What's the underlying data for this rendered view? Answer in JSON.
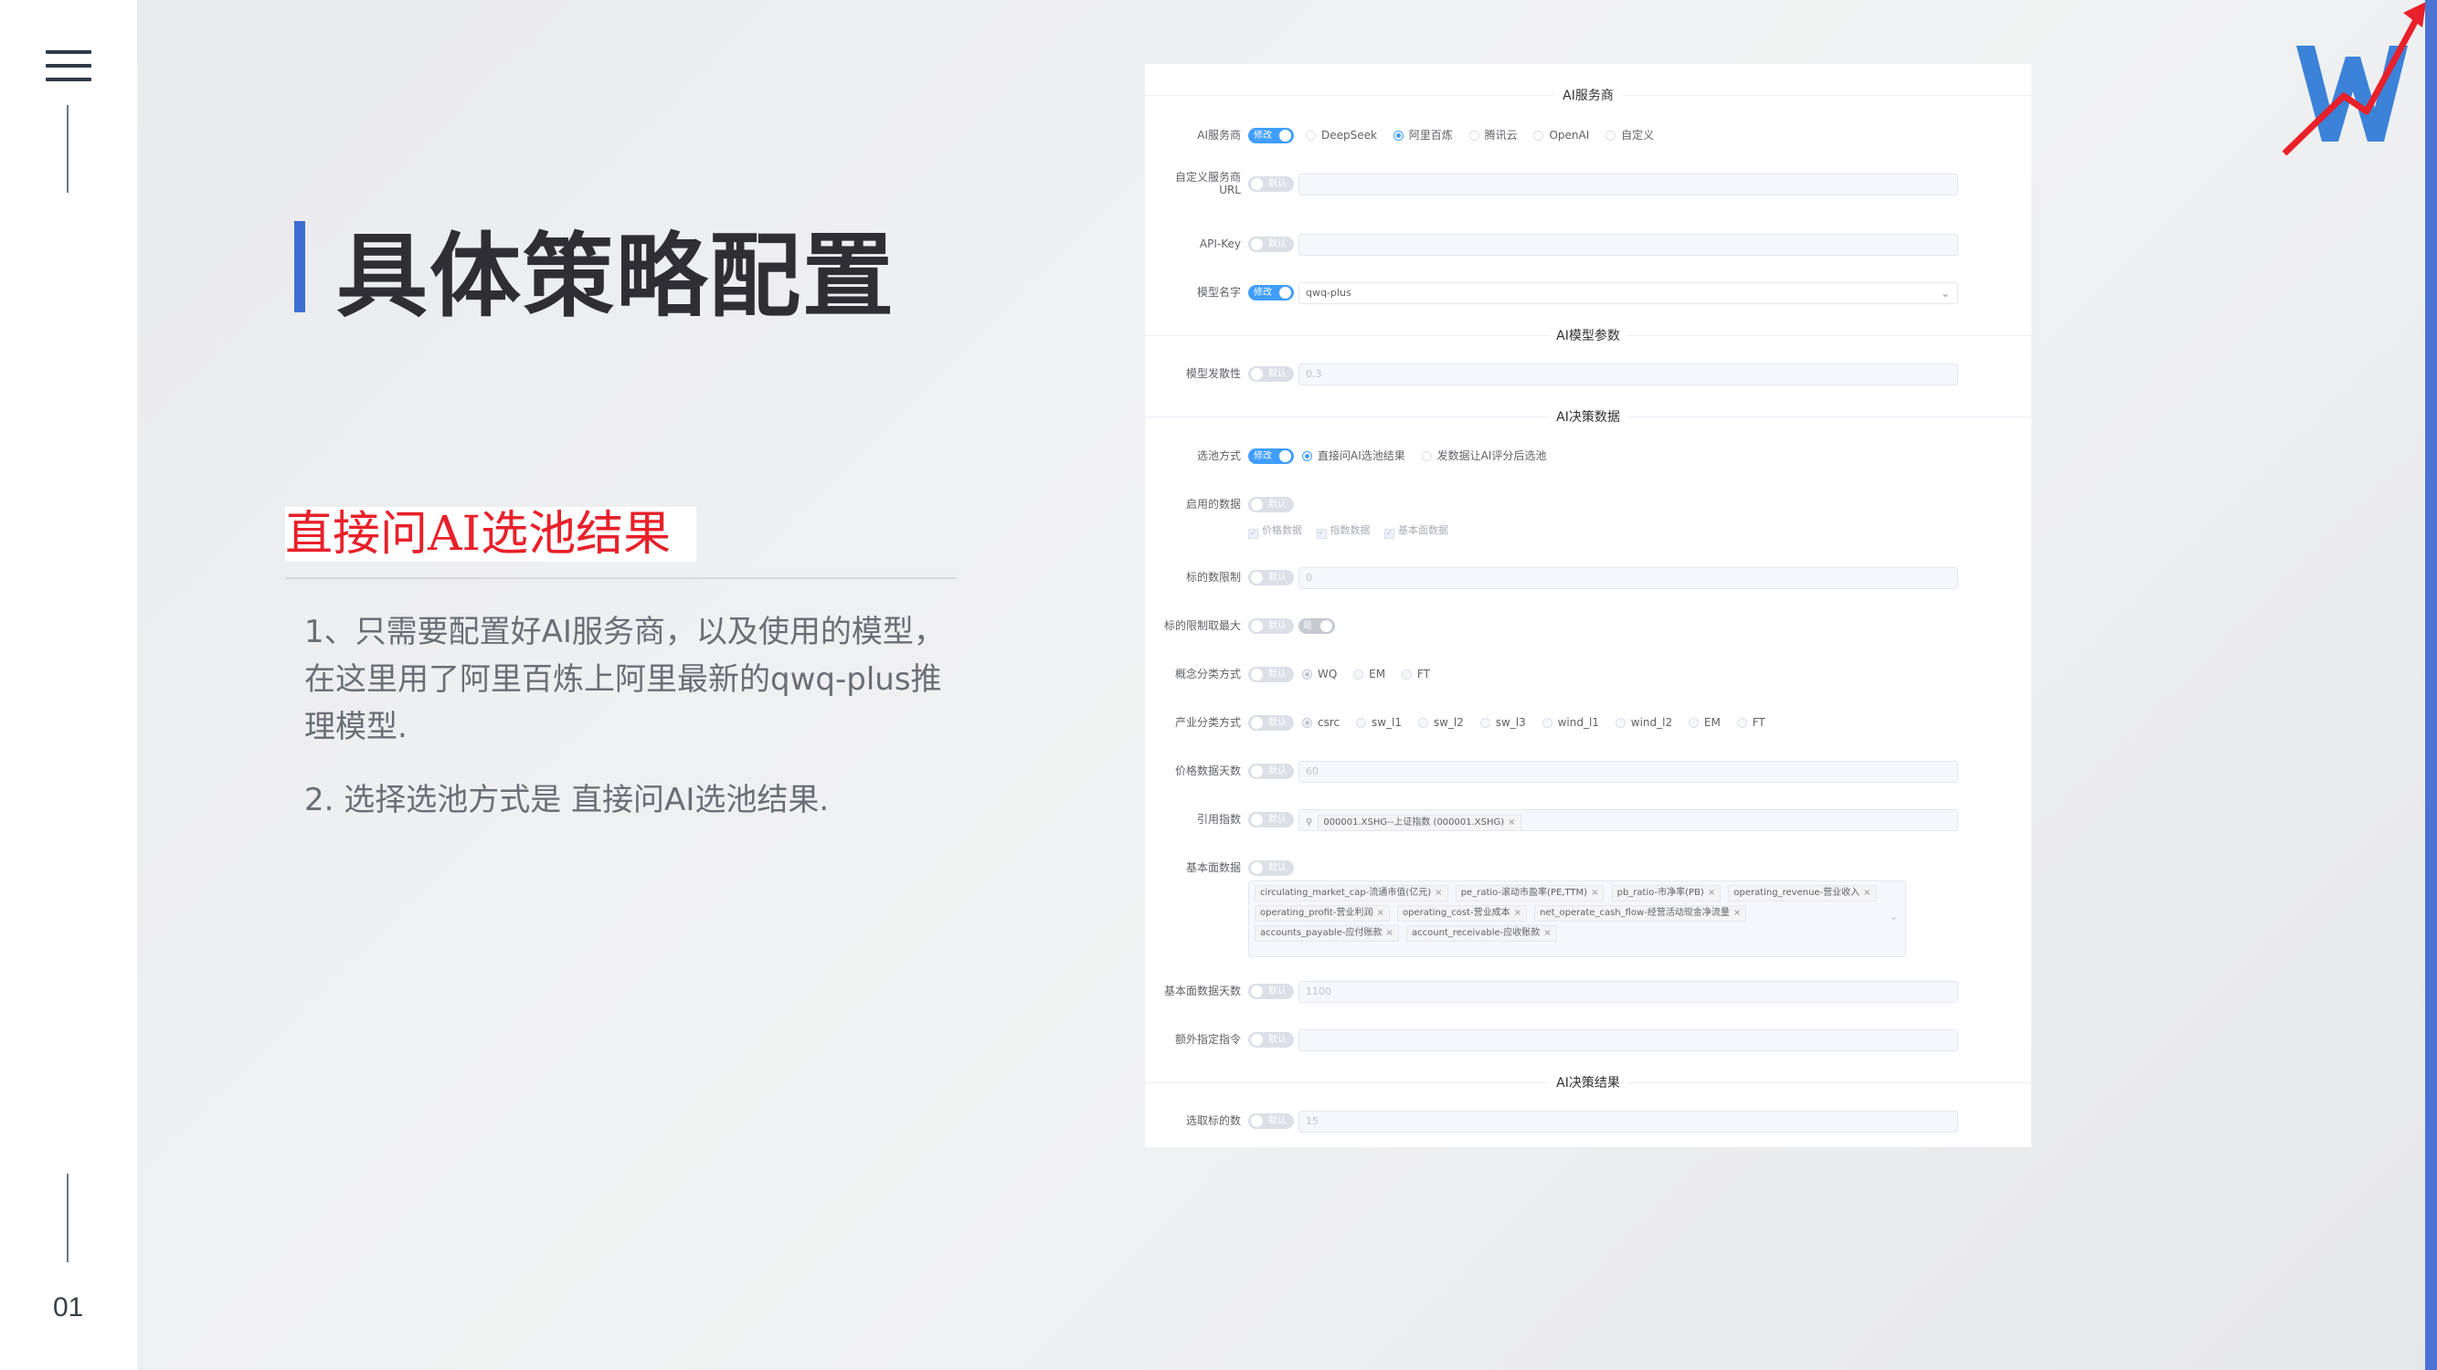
{
  "page": {
    "title": "具体策略配置",
    "page_number": "01"
  },
  "content": {
    "subheading": "直接问AI选池结果",
    "paragraph1": "1、只需要配置好AI服务商，以及使用的模型，在这里用了阿里百炼上阿里最新的qwq-plus推理模型.",
    "paragraph2": "2. 选择选池方式是 直接问AI选池结果."
  },
  "colors": {
    "accent_blue": "#3d6fd1",
    "red_heading": "#e8202a",
    "switch_on": "#409eff"
  },
  "icons": {
    "menu": "hamburger-menu-icon",
    "logo": "w-growth-arrow-logo-icon"
  },
  "app": {
    "switch_edit": "修改",
    "switch_default": "默认",
    "sections": {
      "provider": "AI服务商",
      "model_params": "AI模型参数",
      "decision_data": "AI决策数据",
      "decision_result": "AI决策结果"
    },
    "provider": {
      "label": "AI服务商",
      "options": [
        "DeepSeek",
        "阿里百炼",
        "腾讯云",
        "OpenAI",
        "自定义"
      ],
      "selected": "阿里百炼"
    },
    "custom_url": {
      "label_line1": "自定义服务商",
      "label_line2": "URL",
      "value": ""
    },
    "api_key": {
      "label": "API-Key",
      "value": ""
    },
    "model_name": {
      "label": "模型名字",
      "value": "qwq-plus"
    },
    "divergence": {
      "label": "模型发散性",
      "value": "0.3"
    },
    "select_mode": {
      "label": "选池方式",
      "options": [
        "直接问AI选池结果",
        "发数据让AI评分后选池"
      ],
      "selected": "直接问AI选池结果"
    },
    "enabled_data": {
      "label": "启用的数据",
      "options": [
        "价格数据",
        "指数数据",
        "基本面数据"
      ]
    },
    "target_limit": {
      "label": "标的数限制",
      "value": "0"
    },
    "limit_max": {
      "label": "标的限制取最大",
      "toggle_text": "是"
    },
    "concept_class": {
      "label": "概念分类方式",
      "options": [
        "WQ",
        "EM",
        "FT"
      ],
      "selected": "WQ"
    },
    "industry_class": {
      "label": "产业分类方式",
      "options": [
        "csrc",
        "sw_l1",
        "sw_l2",
        "sw_l3",
        "wind_l1",
        "wind_l2",
        "EM",
        "FT"
      ],
      "selected": "csrc"
    },
    "price_days": {
      "label": "价格数据天数",
      "value": "60"
    },
    "ref_index": {
      "label": "引用指数",
      "tags": [
        "000001.XSHG--上证指数 (000001.XSHG)"
      ]
    },
    "fundamentals": {
      "label": "基本面数据",
      "tags": [
        "circulating_market_cap-流通市值(亿元)",
        "pe_ratio-滚动市盈率(PE,TTM)",
        "pb_ratio-市净率(PB)",
        "operating_revenue-营业收入",
        "operating_profit-营业利润",
        "operating_cost-营业成本",
        "net_operate_cash_flow-经营活动现金净流量",
        "accounts_payable-应付账款",
        "account_receivable-应收账款"
      ]
    },
    "fund_days": {
      "label": "基本面数据天数",
      "value": "1100"
    },
    "extra_cmd": {
      "label": "额外指定指令",
      "value": ""
    },
    "pick_count": {
      "label": "选取标的数",
      "value": "15"
    }
  }
}
